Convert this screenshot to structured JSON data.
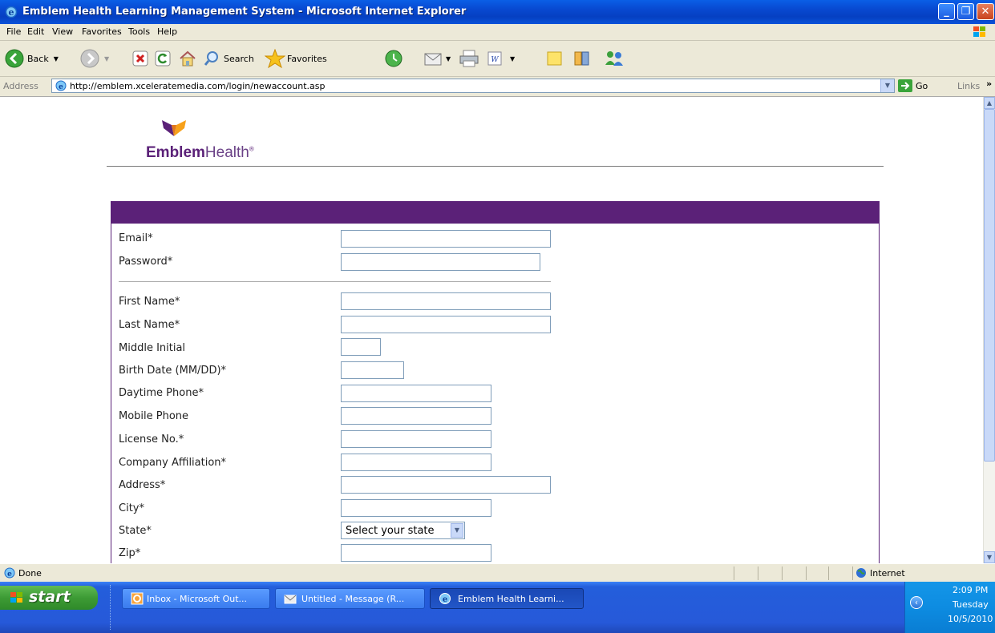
{
  "window": {
    "title": "Emblem Health Learning Management System - Microsoft Internet Explorer"
  },
  "menu": [
    "File",
    "Edit",
    "View",
    "Favorites",
    "Tools",
    "Help"
  ],
  "toolbar": {
    "back": "Back",
    "search": "Search",
    "favorites": "Favorites"
  },
  "address": {
    "label": "Address",
    "url": "http://emblem.xceleratemedia.com/login/newaccount.asp",
    "go": "Go",
    "links": "Links"
  },
  "brand": {
    "name_bold": "Emblem",
    "name_light": "Health",
    "reg": "®"
  },
  "form": {
    "email": "Email*",
    "password": "Password*",
    "first_name": "First Name*",
    "last_name": "Last Name*",
    "middle_initial": "Middle Initial",
    "birth_date": "Birth Date (MM/DD)*",
    "daytime_phone": "Daytime Phone*",
    "mobile_phone": "Mobile Phone",
    "license": "License No.*",
    "company": "Company Affiliation*",
    "address": "Address*",
    "city": "City*",
    "state": "State*",
    "state_select": "Select your state",
    "zip": "Zip*"
  },
  "status": {
    "text": "Done",
    "zone": "Internet"
  },
  "taskbar": {
    "start": "start",
    "items": [
      "Inbox - Microsoft Out...",
      "Untitled - Message (R...",
      "Emblem Health Learni..."
    ],
    "time": "2:09 PM",
    "day": "Tuesday",
    "date": "10/5/2010"
  },
  "colors": {
    "form_header": "#5B2178",
    "brand_purple": "#5B2178",
    "brand_orange": "#F7A11A"
  }
}
